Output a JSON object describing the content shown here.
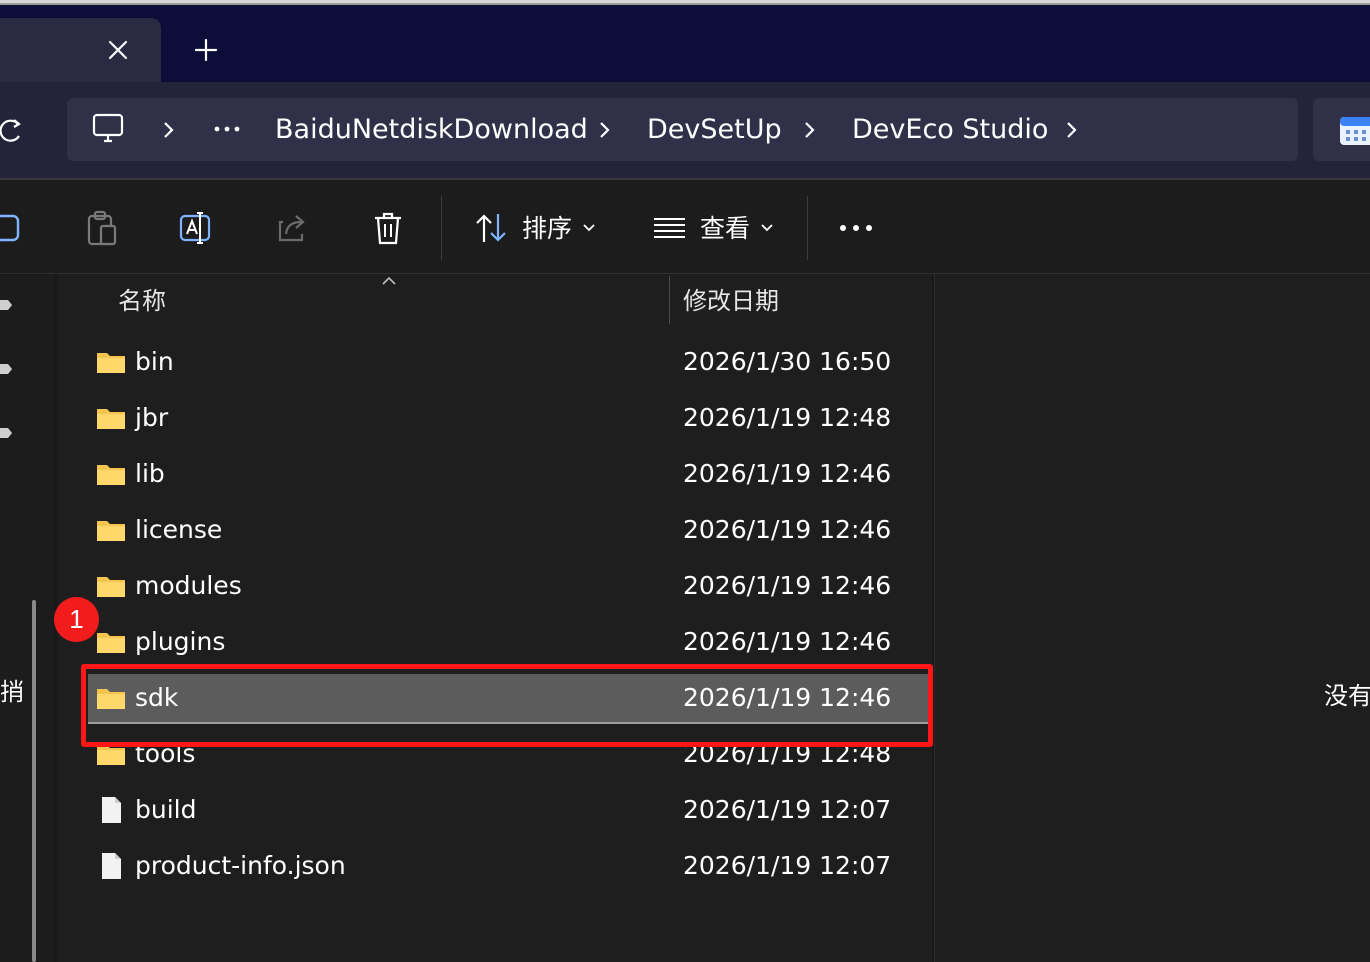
{
  "tabs": {
    "close_icon": "close-icon",
    "new_tab_icon": "plus-icon"
  },
  "address": {
    "more_label": "···",
    "crumbs": [
      "BaiduNetdiskDownload",
      "DevSetUp",
      "DevEco Studio"
    ]
  },
  "toolbar": {
    "sort_label": "排序",
    "view_label": "查看",
    "more_label": "···"
  },
  "navigation": {
    "partial_label": "捎"
  },
  "columns": {
    "name": "名称",
    "modified": "修改日期"
  },
  "files": [
    {
      "name": "bin",
      "modified": "2026/1/30 16:50",
      "type": "folder"
    },
    {
      "name": "jbr",
      "modified": "2026/1/19 12:48",
      "type": "folder"
    },
    {
      "name": "lib",
      "modified": "2026/1/19 12:46",
      "type": "folder"
    },
    {
      "name": "license",
      "modified": "2026/1/19 12:46",
      "type": "folder"
    },
    {
      "name": "modules",
      "modified": "2026/1/19 12:46",
      "type": "folder"
    },
    {
      "name": "plugins",
      "modified": "2026/1/19 12:46",
      "type": "folder"
    },
    {
      "name": "sdk",
      "modified": "2026/1/19 12:46",
      "type": "folder",
      "selected": true
    },
    {
      "name": "tools",
      "modified": "2026/1/19 12:48",
      "type": "folder"
    },
    {
      "name": "build",
      "modified": "2026/1/19 12:07",
      "type": "file"
    },
    {
      "name": "product-info.json",
      "modified": "2026/1/19 12:07",
      "type": "file"
    }
  ],
  "details": {
    "partial_text": "没有"
  },
  "annotation": {
    "step_number": "1"
  },
  "colors": {
    "folder": "#f4c44e",
    "selection": "#5c5c5c",
    "highlight": "#ff1616",
    "badge": "#f21c1c"
  }
}
